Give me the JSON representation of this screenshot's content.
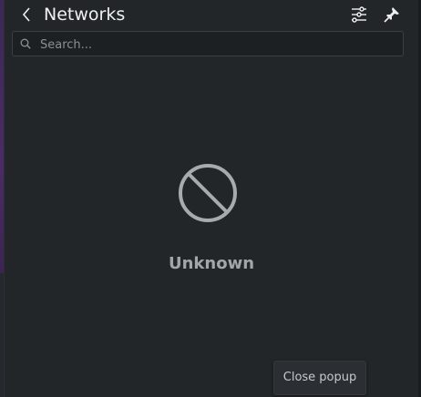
{
  "header": {
    "title": "Networks",
    "back_icon": "chevron-left-icon",
    "configure_icon": "configure-icon",
    "pin_icon": "pin-icon"
  },
  "search": {
    "placeholder": "Search...",
    "value": "",
    "icon": "search-icon"
  },
  "status": {
    "icon": "prohibited-icon",
    "text": "Unknown"
  },
  "tooltip": {
    "text": "Close popup"
  },
  "colors": {
    "panel_bg": "#232629",
    "text_primary": "#eff0f1",
    "text_muted": "#a3a6a9",
    "icon_gray": "#a8abad"
  }
}
